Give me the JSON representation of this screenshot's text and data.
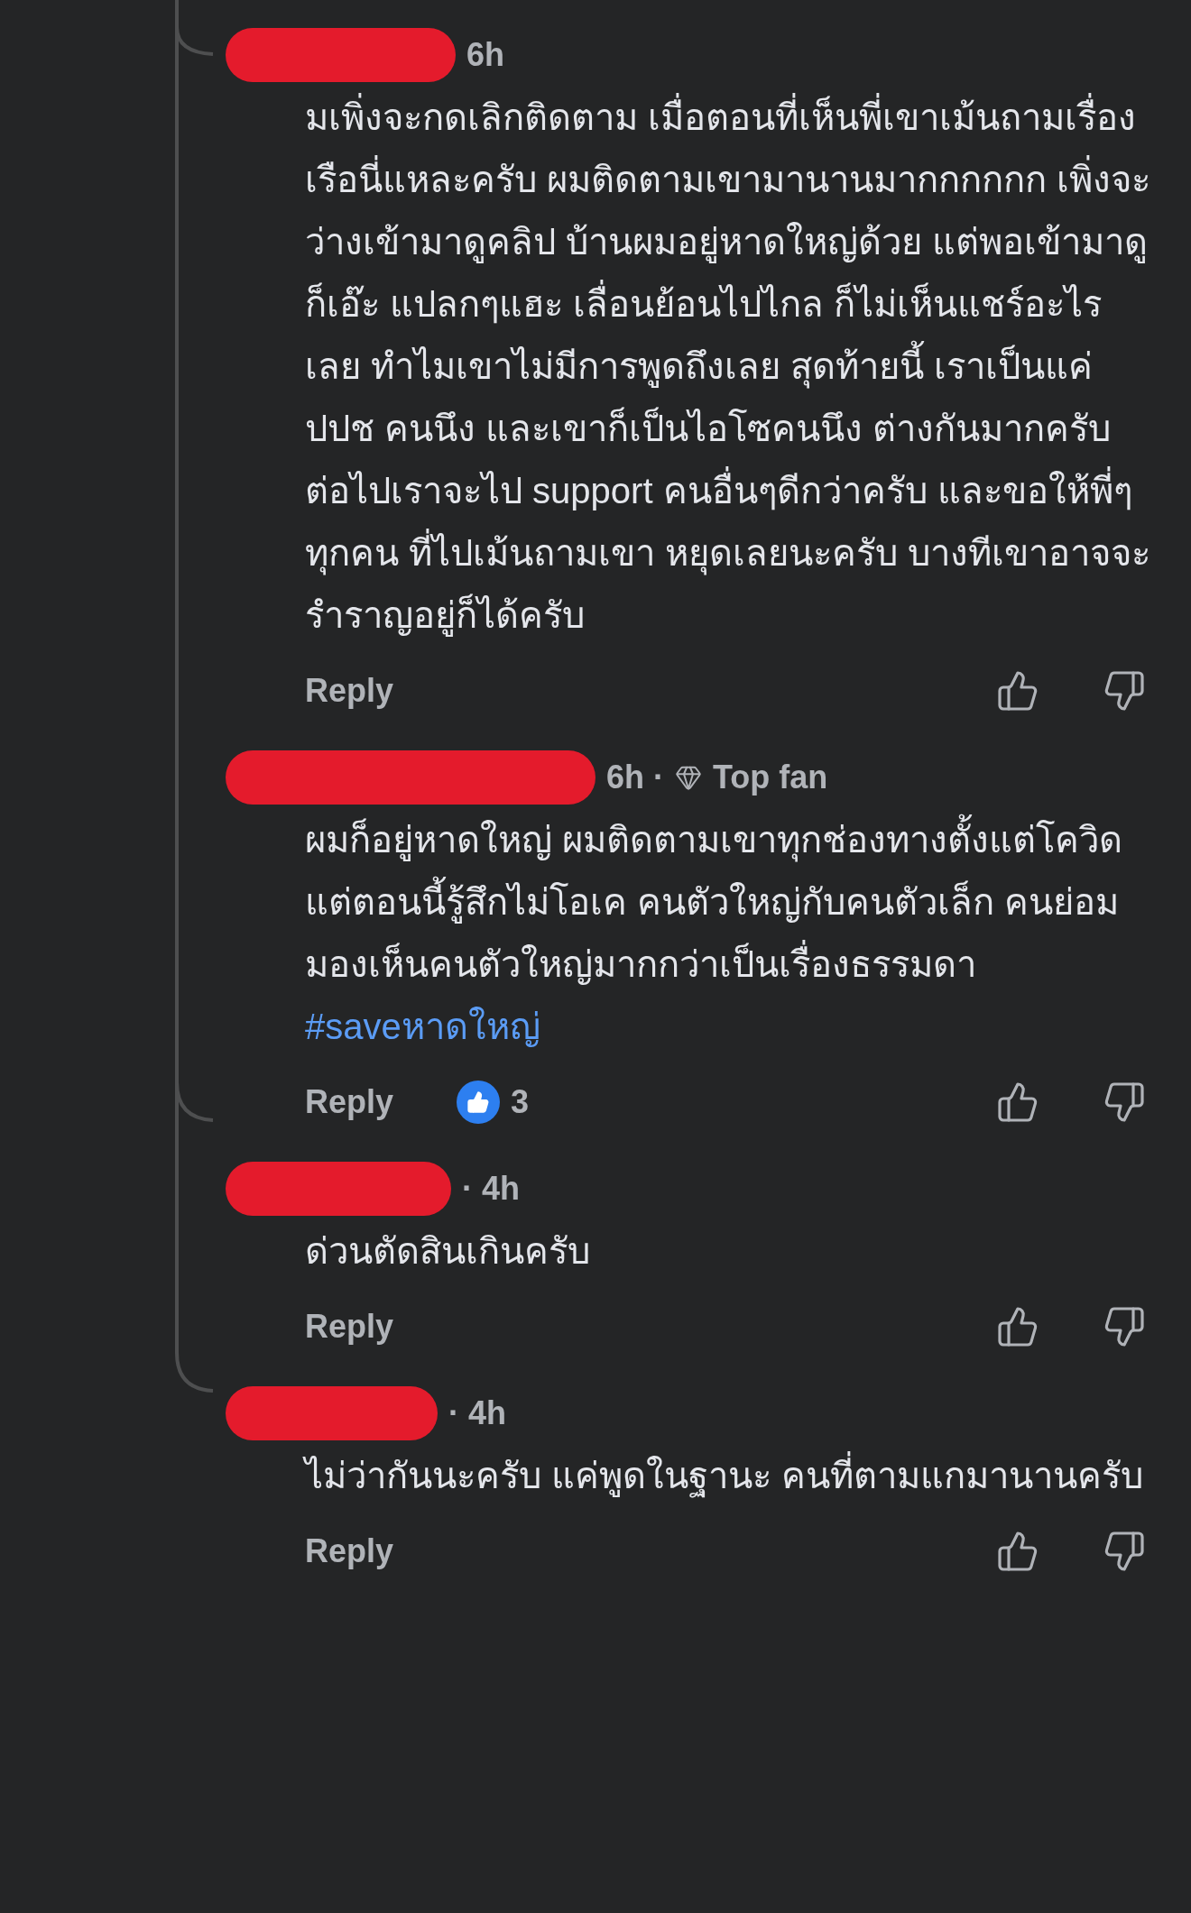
{
  "comments": [
    {
      "author_redacted": true,
      "meta": [
        {
          "kind": "text",
          "text": "6h"
        }
      ],
      "text": "มเพิ่งจะกดเลิกติดตาม เมื่อตอนที่เห็นพี่เขาเม้นถามเรื่องเรือนี่แหละครับ ผมติดตามเขามานานมากกกกกก เพิ่งจะว่างเข้ามาดูคลิป บ้านผมอยู่หาดใหญ่ด้วย แต่พอเข้ามาดูก็เอ๊ะ แปลกๆแฮะ เลื่อนย้อนไปไกล ก็ไม่เห็นแชร์อะไรเลย ทำไมเขาไม่มีการพูดถึงเลย สุดท้ายนี้ เราเป็นแค่ ปปช คนนึง และเขาก็เป็นไอโซคนนึง ต่างกันมากครับ ต่อไปเราจะไป support คนอื่นๆดีกว่าครับ และขอให้พี่ๆทุกคน ที่ไปเม้นถามเขา หยุดเลยนะครับ บางทีเขาอาจจะรำราญอยู่ก็ได้ครับ",
      "reply": "Reply"
    },
    {
      "author_redacted": true,
      "meta": [
        {
          "kind": "text",
          "text": "6h ·"
        },
        {
          "kind": "badge",
          "text": "Top fan"
        }
      ],
      "text": "ผมก็อยู่หาดใหญ่ ผมติดตามเขาทุกช่องทางตั้งแต่โควิด แต่ตอนนี้รู้สึกไม่โอเค คนตัวใหญ่กับคนตัวเล็ก คนย่อมมองเห็นคนตัวใหญ่มากกว่าเป็นเรื่องธรรมดา",
      "hashtag": "#saveหาดใหญ่",
      "reply": "Reply",
      "reaction_count": "3"
    },
    {
      "author_redacted": true,
      "meta": [
        {
          "kind": "text",
          "text": "· 4h"
        }
      ],
      "text": "ด่วนตัดสินเกินครับ",
      "reply": "Reply"
    },
    {
      "author_redacted": true,
      "meta": [
        {
          "kind": "text",
          "text": "· 4h"
        }
      ],
      "text": "ไม่ว่ากันนะครับ แค่พูดในฐานะ คนที่ตามแกมานานครับ",
      "reply": "Reply"
    }
  ]
}
